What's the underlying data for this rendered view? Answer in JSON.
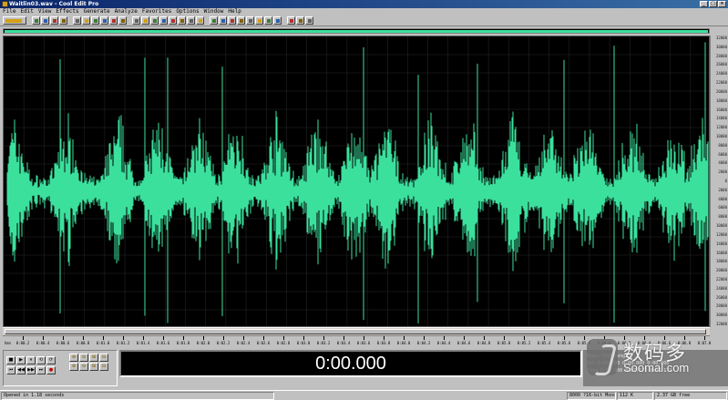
{
  "window": {
    "title": "Waitlin03.wav - Cool Edit Pro",
    "controls": [
      "_",
      "□",
      "×"
    ]
  },
  "menu": [
    "File",
    "Edit",
    "View",
    "Effects",
    "Generate",
    "Analyze",
    "Favorites",
    "Options",
    "Window",
    "Help"
  ],
  "toolbar": {
    "icons": [
      "waveform-view-icon",
      "open-icon",
      "save-icon",
      "record-icon",
      "edit-icon",
      "cut-icon",
      "copy-icon",
      "paste-icon",
      "mix-paste-icon",
      "undo-icon",
      "redo-icon",
      "trim-icon",
      "silence-icon",
      "zoom-icon",
      "loop-icon",
      "spectral-icon",
      "select-icon",
      "scrub-icon",
      "envelope-icon",
      "normalize-icon",
      "noise-icon",
      "amplify-icon",
      "filter-icon",
      "delay-icon",
      "reverb-icon",
      "pitch-icon",
      "marker-icon",
      "cue-icon",
      "help-icon",
      "settings-icon"
    ]
  },
  "amplitude_ruler": [
    "32000",
    "30000",
    "28000",
    "26000",
    "24000",
    "22000",
    "20000",
    "18000",
    "16000",
    "14000",
    "12000",
    "10000",
    "8000",
    "6000",
    "4000",
    "2000",
    "0",
    "2000",
    "4000",
    "6000",
    "8000",
    "10000",
    "12000",
    "14000",
    "16000",
    "18000",
    "20000",
    "22000",
    "24000",
    "26000",
    "28000",
    "30000",
    "32000"
  ],
  "timeline": {
    "unit": "hms",
    "ticks": [
      "0:00.2",
      "0:00.4",
      "0:00.6",
      "0:00.8",
      "0:01.0",
      "0:01.2",
      "0:01.4",
      "0:01.6",
      "0:01.8",
      "0:02.0",
      "0:02.2",
      "0:02.4",
      "0:02.6",
      "0:02.8",
      "0:03.0",
      "0:03.2",
      "0:03.4",
      "0:03.6",
      "0:03.8",
      "0:04.0",
      "0:04.2",
      "0:04.4",
      "0:04.6",
      "0:04.8",
      "0:05.0",
      "0:05.2",
      "0:05.4",
      "0:05.6",
      "0:05.8",
      "0:06.0",
      "0:06.2",
      "0:06.4",
      "0:06.6",
      "0:06.8",
      "0:07.0"
    ]
  },
  "transport": {
    "row1": [
      "■",
      "▶",
      "⏸",
      "⟲",
      "⟳"
    ],
    "row2": [
      "⏮",
      "◀◀",
      "▶▶",
      "⏭",
      "●"
    ],
    "zoom": [
      "⊕",
      "⊖",
      "⊞",
      "⊟",
      "⊕",
      "⊖",
      "⊞",
      "⊟"
    ]
  },
  "time_display": "0:00.000",
  "info": {
    "rows": [
      "Begin    End    Length",
      "Sel  0:00.000  0:00.000  0:00.000",
      "View 0:00.000  0:07.172  0:07.172"
    ]
  },
  "status": {
    "opened": "Opened in 1.18 seconds",
    "format": "8000 ?16-bit Mono",
    "size": "112 K",
    "free": "2.37 GB free"
  },
  "watermark": {
    "cn": "数码多",
    "en": "Soomal.com"
  },
  "colors": {
    "waveform": "#3be09d",
    "background": "#000000",
    "gridline": "#2a2a2a"
  }
}
